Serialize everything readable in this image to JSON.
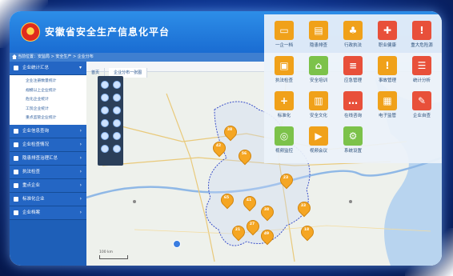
{
  "header": {
    "title": "安徽省安全生产信息化平台"
  },
  "breadcrumb": "当前位置：安监局 > 安全生产 > 企业分布",
  "sidebar": {
    "groups": [
      {
        "label": "企业统计汇总",
        "expanded": true,
        "items": [
          "企业注册数量统计",
          "规模以上企业统计",
          "危化企业统计",
          "工贸企业统计",
          "重点监管企业统计"
        ]
      },
      {
        "label": "企业信息查询"
      },
      {
        "label": "企业检查情况"
      },
      {
        "label": "隐患排查治理汇总"
      },
      {
        "label": "执法检查"
      },
      {
        "label": "重点企业"
      },
      {
        "label": "标准化企业"
      },
      {
        "label": "企业档案"
      }
    ]
  },
  "map": {
    "tabs": [
      "首页",
      "企业分布一张图"
    ],
    "scale": "100 km",
    "pins": [
      "38",
      "42",
      "56",
      "23",
      "65",
      "41",
      "38",
      "27",
      "49",
      "33",
      "21",
      "18"
    ]
  },
  "tiles": [
    {
      "label": "一企一档",
      "color": "#f0a11a",
      "icon": "monitor-icon"
    },
    {
      "label": "隐患排查",
      "color": "#f0a11a",
      "icon": "card-icon"
    },
    {
      "label": "行政执法",
      "color": "#f0a11a",
      "icon": "shirt-icon"
    },
    {
      "label": "职业健康",
      "color": "#e8503a",
      "icon": "medical-icon"
    },
    {
      "label": "重大危险源",
      "color": "#e8503a",
      "icon": "warning-icon"
    },
    {
      "label": "执法检查",
      "color": "#f0a11a",
      "icon": "image-icon"
    },
    {
      "label": "安全培训",
      "color": "#7cc24a",
      "icon": "home-icon"
    },
    {
      "label": "应急管理",
      "color": "#e8503a",
      "icon": "document-icon"
    },
    {
      "label": "事故管理",
      "color": "#f0a11a",
      "icon": "warning-icon"
    },
    {
      "label": "统计分析",
      "color": "#e8503a",
      "icon": "list-icon"
    },
    {
      "label": "标准化",
      "color": "#f0a11a",
      "icon": "plus-card-icon"
    },
    {
      "label": "安全文化",
      "color": "#f0a11a",
      "icon": "book-icon"
    },
    {
      "label": "在线咨询",
      "color": "#e8503a",
      "icon": "chat-icon"
    },
    {
      "label": "电子监管",
      "color": "#f0a11a",
      "icon": "doc-chart-icon"
    },
    {
      "label": "企业自查",
      "color": "#e8503a",
      "icon": "card-edit-icon"
    },
    {
      "label": "视频监控",
      "color": "#7cc24a",
      "icon": "globe-icon"
    },
    {
      "label": "视频会议",
      "color": "#f0a11a",
      "icon": "camera-icon"
    },
    {
      "label": "系统设置",
      "color": "#7cc24a",
      "icon": "gear-icon"
    }
  ]
}
